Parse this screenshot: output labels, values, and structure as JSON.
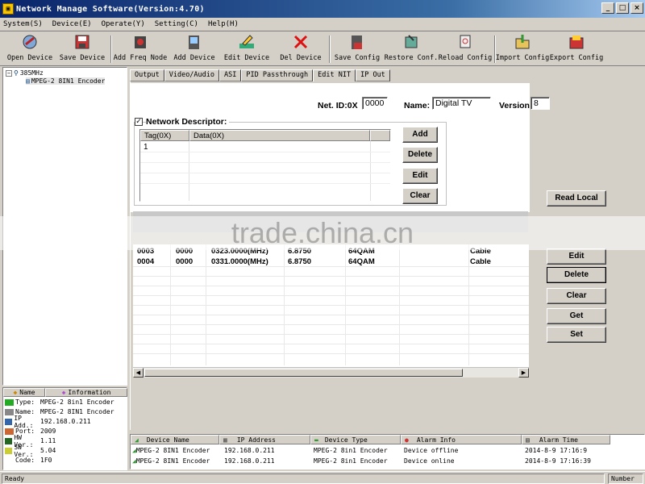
{
  "window": {
    "title": "Network Manage Software(Version:4.70)",
    "min": "_",
    "max": "□",
    "close": "×"
  },
  "menu": [
    "System(S)",
    "Device(E)",
    "Operate(Y)",
    "Setting(C)",
    "Help(H)"
  ],
  "toolbar": [
    {
      "label": "Open Device",
      "icon": "open-device-icon"
    },
    {
      "label": "Save Device",
      "icon": "save-device-icon"
    },
    {
      "label": "Add Freq Node",
      "icon": "add-freq-node-icon"
    },
    {
      "label": "Add Device",
      "icon": "add-device-icon"
    },
    {
      "label": "Edit Device",
      "icon": "edit-device-icon"
    },
    {
      "label": "Del Device",
      "icon": "delete-icon"
    },
    {
      "label": "Save Config",
      "icon": "save-config-icon"
    },
    {
      "label": "Restore Conf.",
      "icon": "restore-config-icon"
    },
    {
      "label": "Reload Config",
      "icon": "reload-config-icon"
    },
    {
      "label": "Import Config",
      "icon": "import-config-icon"
    },
    {
      "label": "Export Config",
      "icon": "export-config-icon"
    }
  ],
  "tree": {
    "root": "385MHz",
    "child": "MPEG-2 8IN1 Encoder"
  },
  "info": {
    "headers": [
      "Name",
      "Information"
    ],
    "rows": [
      {
        "k": "Type:",
        "v": "MPEG-2 8in1 Encoder"
      },
      {
        "k": "Name:",
        "v": "MPEG-2 8IN1 Encoder"
      },
      {
        "k": "IP Add.:",
        "v": "192.168.0.211"
      },
      {
        "k": "Port:",
        "v": "2009"
      },
      {
        "k": "HW Ver.:",
        "v": "1.11"
      },
      {
        "k": "SW Ver.:",
        "v": "5.04"
      },
      {
        "k": "Code:",
        "v": "1F0"
      }
    ]
  },
  "tabs": [
    "Output",
    "Video/Audio",
    "ASI",
    "PID Passthrough",
    "Edit NIT",
    "IP Out"
  ],
  "active_tab": "Edit NIT",
  "nit": {
    "net_id_label": "Net. ID:0X",
    "net_id": "0000",
    "name_label": "Name:",
    "name": "Digital TV",
    "version_label": "Version",
    "version": "8",
    "nd_label": "Network Descriptor:",
    "nd_checked": "✓",
    "nd_headers": [
      "Tag(0X)",
      "Data(0X)"
    ],
    "nd_rows": [
      {
        "tag": "1",
        "data": ""
      }
    ],
    "nd_buttons": [
      "Add",
      "Delete",
      "Edit",
      "Clear"
    ]
  },
  "right_buttons": [
    "Read Local",
    "Edit",
    "Delete",
    "Clear",
    "Get",
    "Set"
  ],
  "watermark": "trade.china.cn",
  "freq_rows": [
    {
      "a": "0003",
      "b": "0000",
      "freq": "0323.0000(MHz)",
      "sr": "6.8750",
      "mod": "64QAM",
      "type": "Cable"
    },
    {
      "a": "0004",
      "b": "0000",
      "freq": "0331.0000(MHz)",
      "sr": "6.8750",
      "mod": "64QAM",
      "type": "Cable"
    }
  ],
  "alarm": {
    "headers": [
      "Device Name",
      "IP Address",
      "Device Type",
      "Alarm Info",
      "Alarm Time"
    ],
    "rows": [
      {
        "name": "MPEG-2 8IN1 Encoder",
        "ip": "192.168.0.211",
        "type": "MPEG-2 8in1 Encoder",
        "info": "Device offline",
        "time": "2014-8-9 17:16:9"
      },
      {
        "name": "MPEG-2 8IN1 Encoder",
        "ip": "192.168.0.211",
        "type": "MPEG-2 8in1 Encoder",
        "info": "Device online",
        "time": "2014-8-9 17:16:39"
      }
    ]
  },
  "status": {
    "ready": "Ready",
    "number": "Number"
  }
}
